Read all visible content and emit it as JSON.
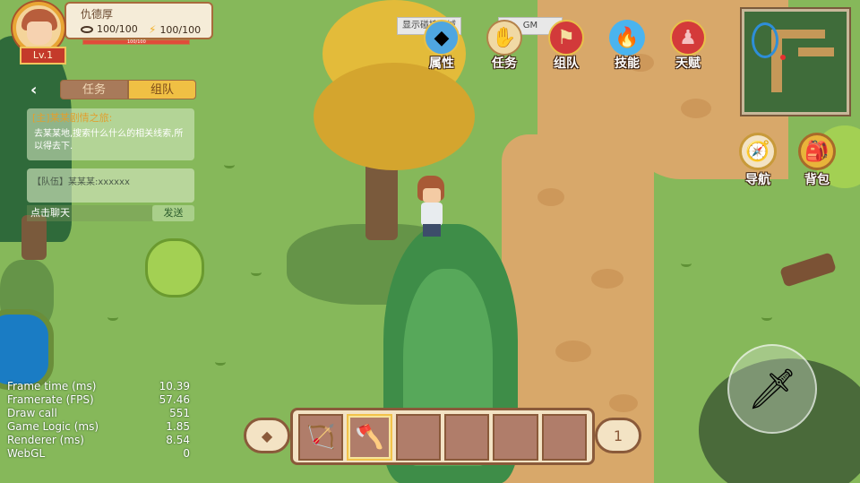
{
  "player": {
    "name": "仇德厚",
    "level": "Lv.1",
    "hp": "100/100",
    "mp": "100/100",
    "bar_label": "100/100",
    "hp_fill": 1.0
  },
  "panel": {
    "tabs": [
      "任务",
      "组队"
    ],
    "active_tab": "组队",
    "quest_title": "[主]某某剧情之旅:",
    "quest_desc": "去某某地,搜索什么什么的相关线索,所以得去下.",
    "team_message": "【队伍】某某某:xxxxxx",
    "chat_placeholder": "点击聊天",
    "send_label": "发送"
  },
  "top": {
    "collision_tag": "显示碰撞区域",
    "gm_tag": "GM",
    "menu": [
      {
        "label": "属性",
        "icon": "attribute-icon"
      },
      {
        "label": "任务",
        "icon": "quest-icon"
      },
      {
        "label": "组队",
        "icon": "team-flag-icon"
      },
      {
        "label": "技能",
        "icon": "skill-flame-icon"
      },
      {
        "label": "天赋",
        "icon": "talent-icon"
      }
    ]
  },
  "side": {
    "navigate": "导航",
    "bag": "背包"
  },
  "debug": {
    "rows": [
      {
        "label": "Frame time (ms)",
        "value": "10.39"
      },
      {
        "label": "Framerate (FPS)",
        "value": "57.46"
      },
      {
        "label": "Draw call",
        "value": "551"
      },
      {
        "label": "Game Logic (ms)",
        "value": "1.85"
      },
      {
        "label": "Renderer (ms)",
        "value": "8.54"
      },
      {
        "label": "WebGL",
        "value": "0"
      }
    ]
  },
  "hotbar": {
    "slots": [
      "bow-icon",
      "axe-icon",
      "",
      "",
      "",
      ""
    ],
    "selected": 1,
    "page": "1"
  },
  "colors": {
    "grass": "#86b85a",
    "path": "#d8a86a",
    "panel": "#f3e3c4"
  }
}
